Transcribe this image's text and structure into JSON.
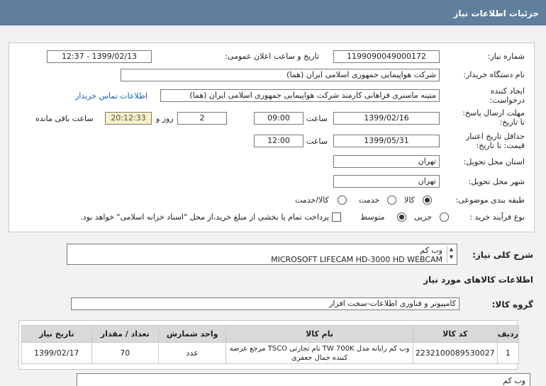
{
  "header": {
    "title": "جزئیات اطلاعات نیاز"
  },
  "form": {
    "need_number_label": "شماره نیاز:",
    "need_number": "1199090049000172",
    "announce_label": "تاریخ و ساعت اعلان عمومی:",
    "announce_value": "1399/02/13 - 12:37",
    "buyer_label": "نام دستگاه خریدار:",
    "buyer_value": "شرکت هواپیمایی جمهوری اسلامی ایران (هما)",
    "creator_label_1": "ایجاد کننده",
    "creator_label_2": "درخواست:",
    "creator_value": "متینه ماستری فراهانی کارمند شرکت هواپیمایی جمهوری اسلامی ایران (هما)",
    "contact_link": "اطلاعات تماس خریدار",
    "deadline_label_1": "مهلت ارسال پاسخ:",
    "deadline_label_2": "تا تاریخ:",
    "deadline_date": "1399/02/16",
    "time_label": "ساعت",
    "deadline_time": "09:00",
    "days_value": "2",
    "days_label": "روز و",
    "remaining_value": "20:12:33",
    "remaining_label": "ساعت باقی مانده",
    "validity_label_1": "حداقل تاریخ اعتبار",
    "validity_label_2": "قیمت: تا تاریخ:",
    "validity_date": "1399/05/31",
    "validity_time": "12:00",
    "province_label": "استان محل تحویل:",
    "province_value": "تهران",
    "city_label": "شهر محل تحویل:",
    "city_value": "تهران",
    "category_label": "طبقه بندی موضوعی:",
    "category_options": [
      "کالا",
      "خدمت",
      "کالا/خدمت"
    ],
    "category_selected": "کالا",
    "process_label": "نوع فرآیند خرید :",
    "process_options": [
      "جزیی",
      "متوسط"
    ],
    "process_selected": "متوسط",
    "payment_note": "پرداخت تمام یا بخشی از مبلغ خرید،از محل \"اسناد خزانه اسلامی\" خواهد بود."
  },
  "description": {
    "label": "شرح کلی نیاز:",
    "line1": "وب کم",
    "line2": "MICROSOFT LIFECAM HD-3000 HD WEBCAM"
  },
  "goods_info_title": "اطلاعات کالاهای مورد نیاز",
  "goods_group": {
    "label": "گروه کالا:",
    "value": "کامپیوتر و فناوری اطلاعات-سخت افزار"
  },
  "table": {
    "headers": [
      "ردیف",
      "کد کالا",
      "نام کالا",
      "واحد شمارش",
      "تعداد / مقدار",
      "تاریخ نیاز"
    ],
    "rows": [
      {
        "row": "1",
        "code": "2232100089530027",
        "name_line1": "وب کم رایانه مدل TW 700K نام تجارتی TSCO مرجع عرضه",
        "name_line2": "کننده جمال جعفری",
        "unit": "عدد",
        "qty": "70",
        "date": "1399/02/17"
      }
    ]
  },
  "bottom_note": "وب کم"
}
